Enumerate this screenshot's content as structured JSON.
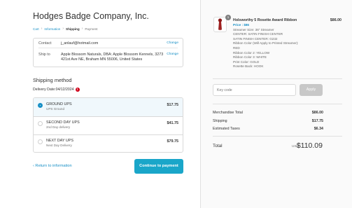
{
  "store": {
    "name": "Hodges Badge Company, Inc."
  },
  "breadcrumb": [
    {
      "label": "Cart",
      "state": "link"
    },
    {
      "label": "Information",
      "state": "link"
    },
    {
      "label": "Shipping",
      "state": "current"
    },
    {
      "label": "Payment",
      "state": "upcoming"
    }
  ],
  "breadcrumb_separator": "›",
  "contact": {
    "contact_label": "Contact",
    "contact_value": "j_anlauf@hotmail.com",
    "ship_label": "Ship to",
    "ship_value": "Apple Blossom Naturals, DBA: Apple Blossom Kennels, 3273 421st Ave NE, Braham MN 55006, United States",
    "change_label": "Change"
  },
  "shipping": {
    "title": "Shipping method",
    "delivery_date": "Delivery Date:04/12/2024",
    "info_icon": "info-icon",
    "methods": [
      {
        "name": "GROUND UPS",
        "sub": "UPS Ground",
        "price": "$17.75",
        "selected": true
      },
      {
        "name": "SECOND DAY UPS",
        "sub": "2nd Day delivery",
        "price": "$41.75",
        "selected": false
      },
      {
        "name": "NEXT DAY UPS",
        "sub": "Next Day Delivery",
        "price": "$79.75",
        "selected": false
      }
    ]
  },
  "footer": {
    "return_label": "Return to information",
    "return_icon": "chevron-left-icon",
    "continue_label": "Continue to payment"
  },
  "summary": {
    "product": {
      "quantity": "1",
      "name": "Holsworthy 5 Rosette Award Ribbon",
      "price": "$86.00",
      "attrs": [
        {
          "text": "Price : $86",
          "highlight": true
        },
        {
          "text": "Streamer Size: 36\" Streamer",
          "highlight": false
        },
        {
          "text": "CENTER: SATIN FINISH CENTER",
          "highlight": false
        },
        {
          "text": "SATIN FINISH CENTER: G232",
          "highlight": false
        },
        {
          "text": "Ribbon Color (Will Apply to Printed Streamer):",
          "highlight": false
        },
        {
          "text": "RED",
          "highlight": false
        },
        {
          "text": "Ribbon Color 2: YELLOW",
          "highlight": false
        },
        {
          "text": "Ribbon Color 3: WHITE",
          "highlight": false
        },
        {
          "text": "Print Color: GOLD",
          "highlight": false
        },
        {
          "text": "Rosette Back: HOOK",
          "highlight": false
        }
      ]
    },
    "discount": {
      "placeholder": "Key code",
      "apply_label": "Apply"
    },
    "rows": [
      {
        "label": "Merchandise Total",
        "value": "$86.00"
      },
      {
        "label": "Shipping",
        "value": "$17.75"
      },
      {
        "label": "Estimated Taxes",
        "value": "$6.34"
      }
    ],
    "total": {
      "label": "Total",
      "currency": "USD",
      "value": "$110.09"
    }
  },
  "colors": {
    "accent": "#1990c6",
    "button": "#1aa6c9",
    "error": "#d0021b",
    "ribbon": "#8b1a1a"
  }
}
